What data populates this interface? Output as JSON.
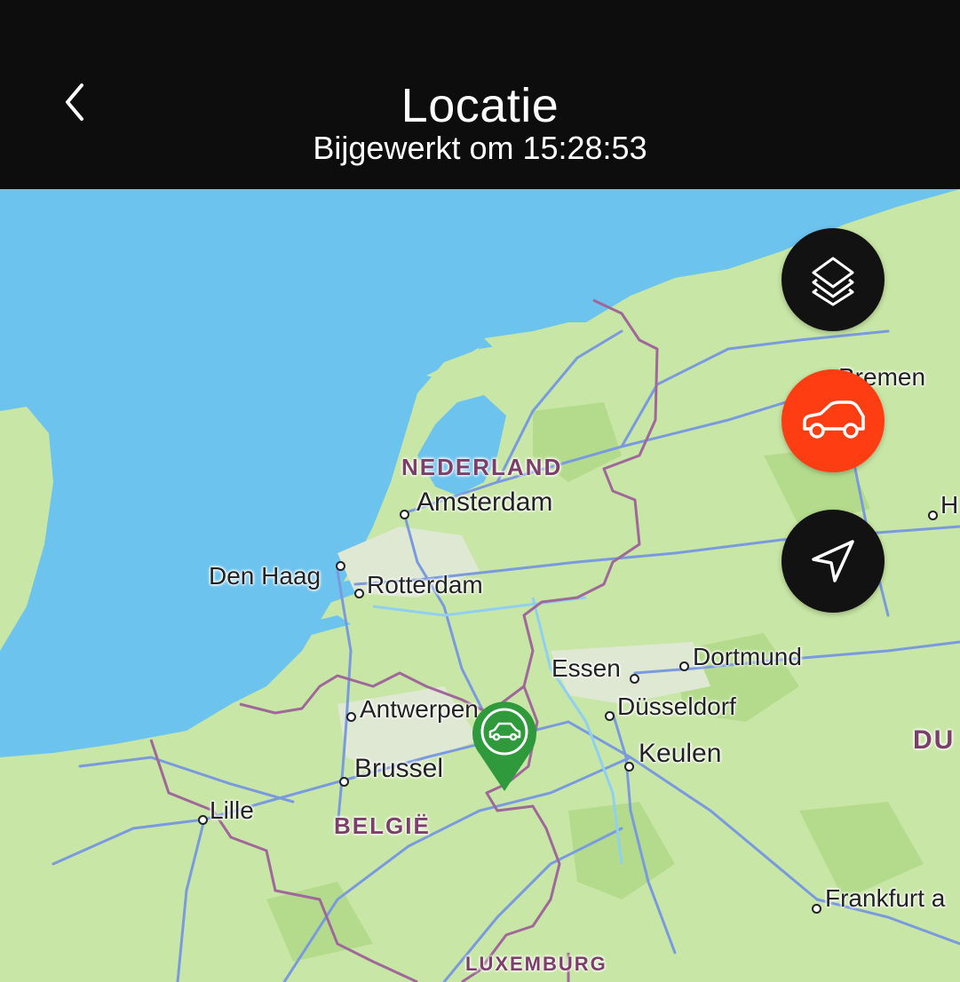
{
  "header": {
    "title": "Locatie",
    "subtitle": "Bijgewerkt om 15:28:53",
    "back_icon": "chevron-left-icon"
  },
  "map": {
    "countries": {
      "nl": "NEDERLAND",
      "be": "BELGIË",
      "lu": "LUXEMBURG",
      "de": "DU"
    },
    "cities": {
      "amsterdam": "Amsterdam",
      "den_haag": "Den Haag",
      "rotterdam": "Rotterdam",
      "antwerpen": "Antwerpen",
      "brussel": "Brussel",
      "lille": "Lille",
      "essen": "Essen",
      "dortmund": "Dortmund",
      "dusseldorf": "Düsseldorf",
      "keulen": "Keulen",
      "bremen": "Bremen",
      "frankfurt": "Frankfurt a",
      "h": "H"
    },
    "colors": {
      "land": "#c8e6a5",
      "water": "#6cc3ee",
      "border": "#a0679a",
      "road": "#7a9ae0",
      "marker": "#2e9a3c",
      "car_button": "#ff3d12",
      "dark_button": "#121212"
    }
  },
  "controls": {
    "layers_icon": "layers-icon",
    "car_icon": "car-icon",
    "navigate_icon": "navigation-arrow-icon"
  }
}
